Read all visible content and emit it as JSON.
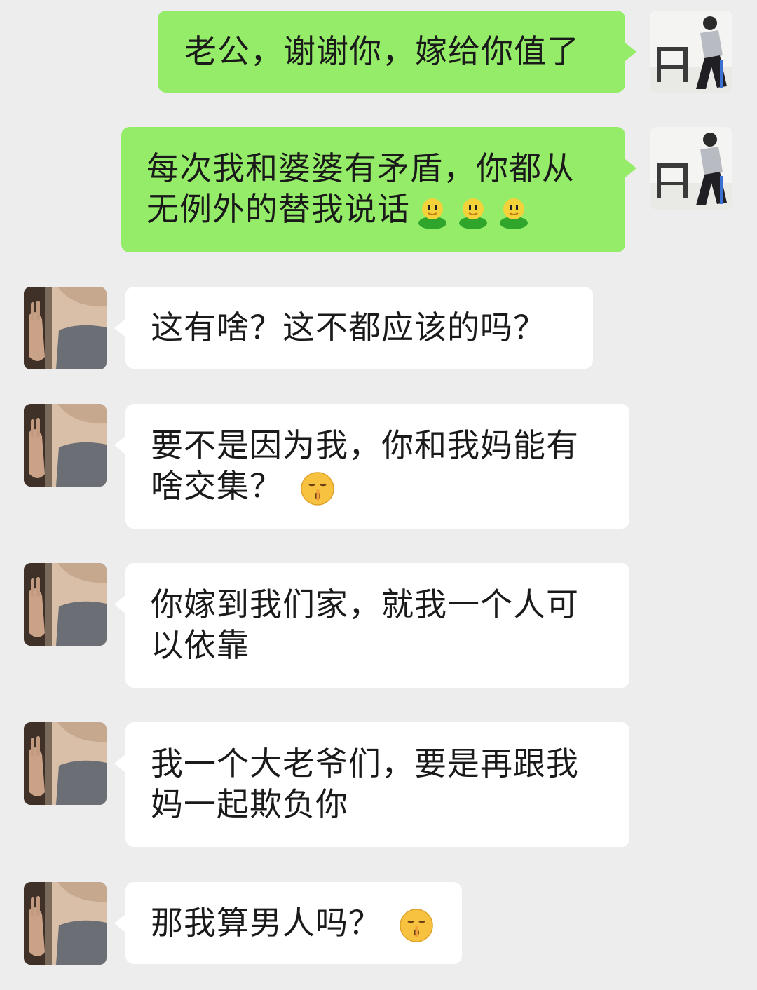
{
  "conversation": {
    "messages": [
      {
        "sender": "self",
        "lines": [
          "老公，谢谢你，嫁给你值了"
        ],
        "emoji": []
      },
      {
        "sender": "self",
        "lines": [
          "每次我和婆婆有矛盾，你都从",
          "无例外的替我说话"
        ],
        "emoji": [
          "green-man-emoji",
          "green-man-emoji",
          "green-man-emoji"
        ]
      },
      {
        "sender": "other",
        "lines": [
          "这有啥？这不都应该的吗？"
        ],
        "emoji": []
      },
      {
        "sender": "other",
        "lines": [
          "要不是因为我，你和我妈能有",
          "啥交集？"
        ],
        "emoji": [
          "hush-face-emoji"
        ]
      },
      {
        "sender": "other",
        "lines": [
          "你嫁到我们家，就我一个人可",
          "以依靠"
        ],
        "emoji": []
      },
      {
        "sender": "other",
        "lines": [
          "我一个大老爷们，要是再跟我",
          "妈一起欺负你"
        ],
        "emoji": []
      },
      {
        "sender": "other",
        "lines": [
          "那我算男人吗？"
        ],
        "emoji": [
          "hush-face-emoji"
        ]
      }
    ]
  },
  "colors": {
    "background": "#ededed",
    "sent_bubble": "#95ec69",
    "received_bubble": "#ffffff",
    "text": "#1a1a1a"
  }
}
